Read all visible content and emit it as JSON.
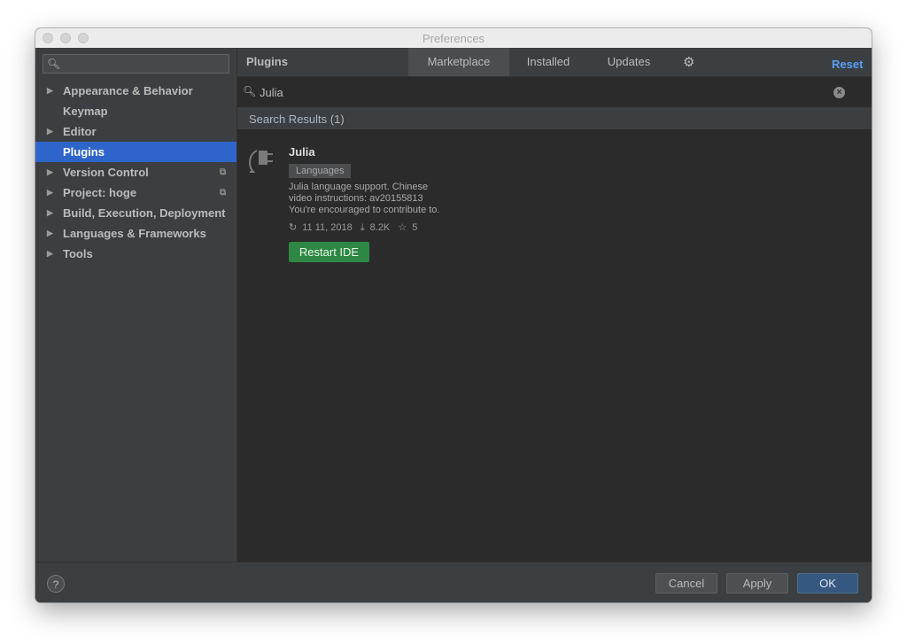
{
  "window": {
    "title": "Preferences"
  },
  "sidebar": {
    "search_placeholder": "",
    "items": [
      {
        "label": "Appearance & Behavior",
        "expandable": true
      },
      {
        "label": "Keymap",
        "expandable": false
      },
      {
        "label": "Editor",
        "expandable": true
      },
      {
        "label": "Plugins",
        "expandable": false,
        "selected": true
      },
      {
        "label": "Version Control",
        "expandable": true,
        "has_copy_icon": true
      },
      {
        "label": "Project: hoge",
        "expandable": true,
        "has_copy_icon": true
      },
      {
        "label": "Build, Execution, Deployment",
        "expandable": true
      },
      {
        "label": "Languages & Frameworks",
        "expandable": true
      },
      {
        "label": "Tools",
        "expandable": true
      }
    ],
    "arrow_glyph": "▶",
    "copy_glyph": "⧉"
  },
  "plugins": {
    "title": "Plugins",
    "tabs": [
      {
        "label": "Marketplace",
        "active": true
      },
      {
        "label": "Installed",
        "active": false
      },
      {
        "label": "Updates",
        "active": false
      }
    ],
    "reset_label": "Reset",
    "search": {
      "query": "Julia"
    },
    "results_header": "Search Results (1)",
    "result": {
      "name": "Julia",
      "category": "Languages",
      "description": "Julia language support. Chinese video instructions: av20155813 You're encouraged to contribute to.",
      "description_lines": [
        "Julia language support. Chinese",
        "video instructions: av20155813",
        "You're encouraged to contribute to."
      ],
      "date": "11 11, 2018",
      "downloads": "8.2K",
      "rating": "5",
      "action_label": "Restart IDE"
    }
  },
  "footer": {
    "help_label": "?",
    "cancel_label": "Cancel",
    "apply_label": "Apply",
    "ok_label": "OK"
  },
  "colors": {
    "selection": "#2f65ca",
    "accent_link": "#589df6",
    "restart_button": "#2e8744",
    "ok_button": "#365880"
  }
}
